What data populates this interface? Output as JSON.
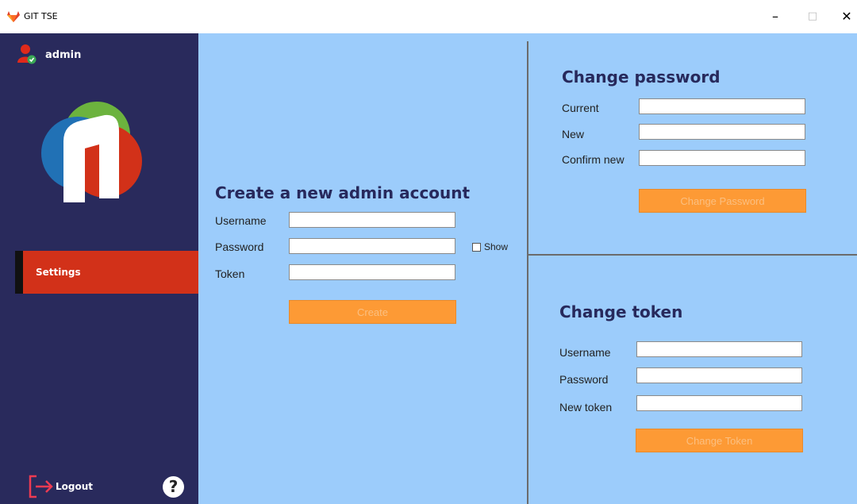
{
  "window": {
    "title": "GIT TSE",
    "minimize_glyph": "–",
    "maximize_glyph": "□",
    "close_glyph": "✕"
  },
  "sidebar": {
    "user_name": "admin",
    "nav": [
      {
        "label": "Settings",
        "active": true
      }
    ],
    "logout_label": "Logout",
    "help_glyph": "?"
  },
  "create_admin": {
    "heading": "Create a new admin account",
    "username_label": "Username",
    "username_value": "",
    "password_label": "Password",
    "password_value": "",
    "show_label": "Show",
    "show_checked": false,
    "token_label": "Token",
    "token_value": "",
    "button_label": "Create"
  },
  "change_password": {
    "heading": "Change password",
    "current_label": "Current",
    "new_label": "New",
    "confirm_label": "Confirm new",
    "button_label": "Change Password"
  },
  "change_token": {
    "heading": "Change token",
    "username_label": "Username",
    "password_label": "Password",
    "new_token_label": "New token",
    "button_label": "Change Token"
  },
  "colors": {
    "sidebar_bg": "#292a5c",
    "main_bg": "#9cccfb",
    "active_nav": "#d23119",
    "button_bg": "#fd9a35",
    "heading": "#27295c"
  },
  "icons": [
    "gitlab-fox-icon",
    "user-check-icon",
    "logo-icon",
    "logout-arrow-icon",
    "help-icon"
  ]
}
